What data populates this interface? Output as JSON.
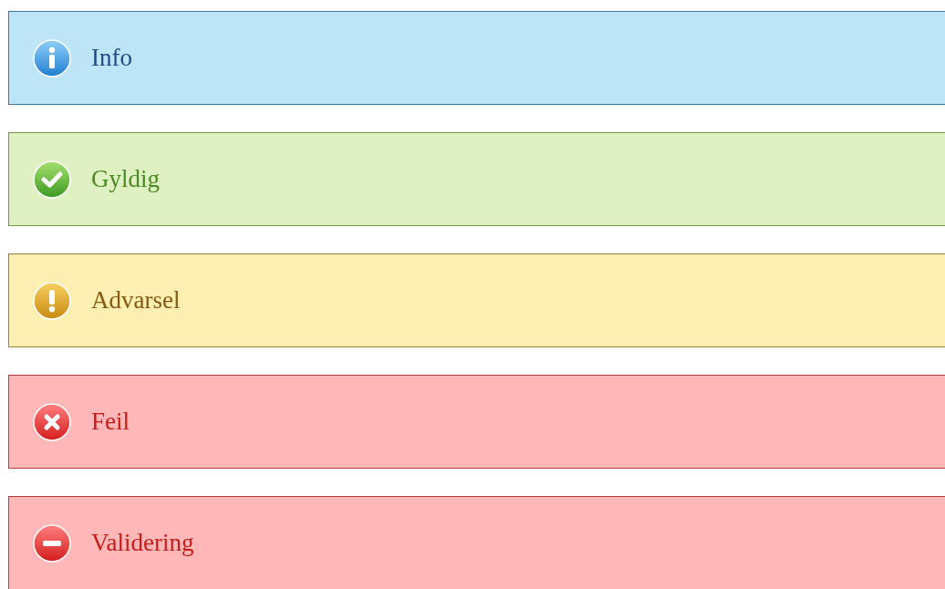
{
  "messages": [
    {
      "kind": "info",
      "text": "Info"
    },
    {
      "kind": "success",
      "text": "Gyldig"
    },
    {
      "kind": "warning",
      "text": "Advarsel"
    },
    {
      "kind": "error",
      "text": "Feil"
    },
    {
      "kind": "validation",
      "text": "Validering"
    }
  ]
}
